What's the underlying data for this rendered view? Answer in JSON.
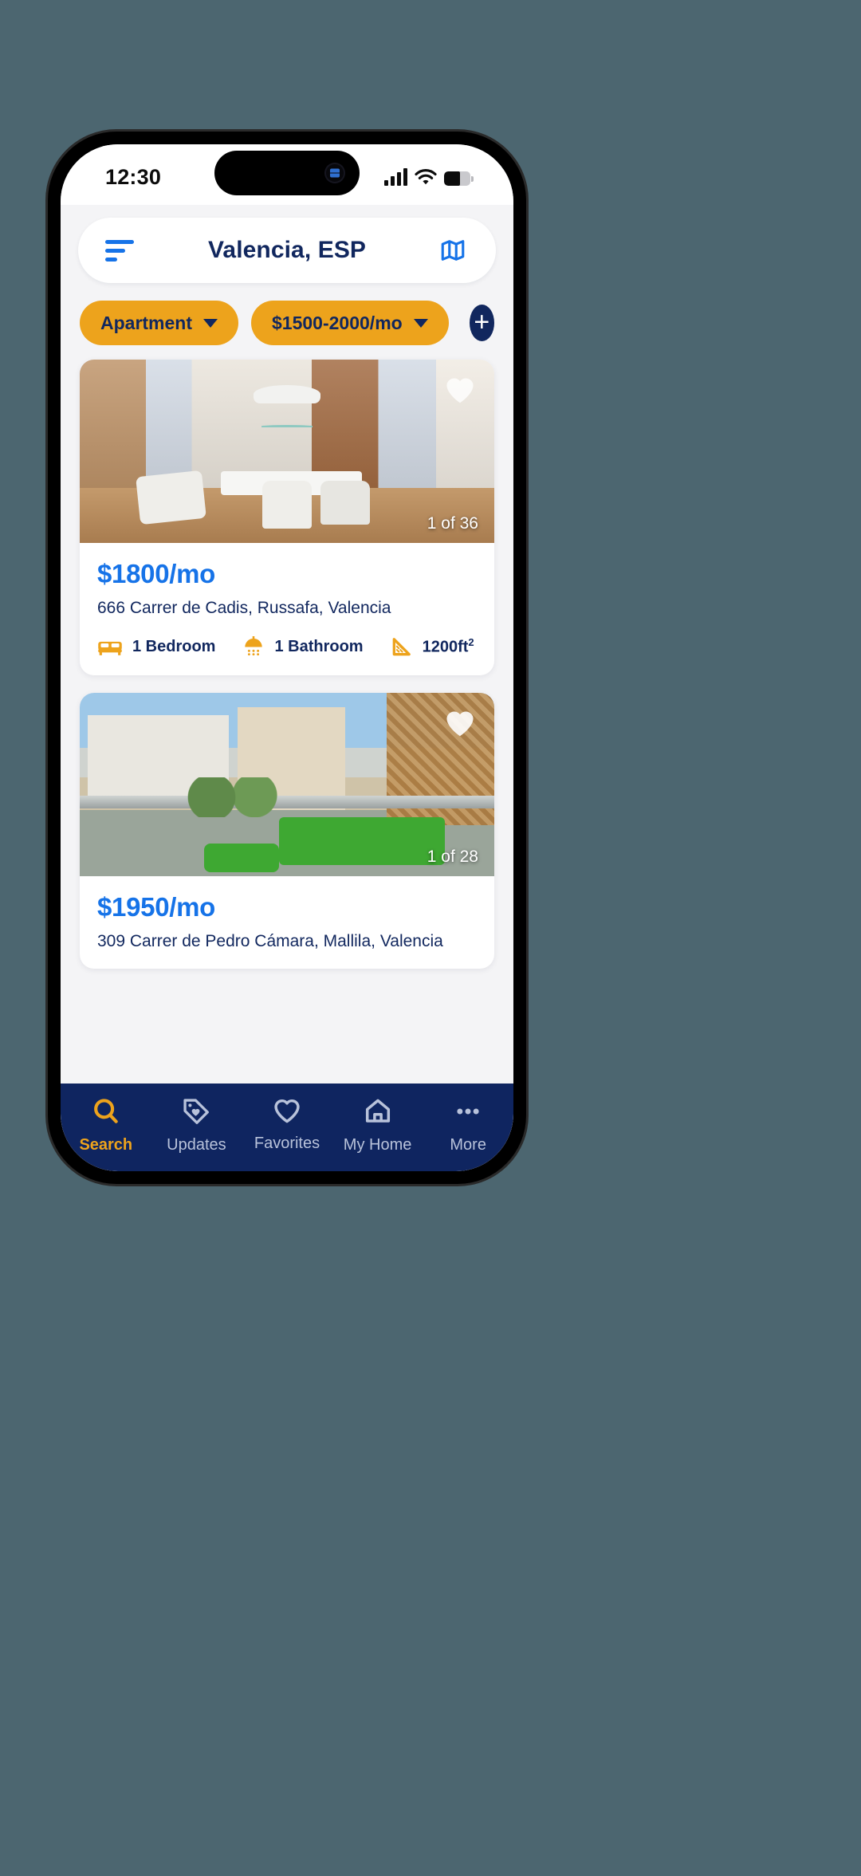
{
  "status_bar": {
    "time": "12:30",
    "signal_icon": "cellular-signal-icon",
    "wifi_icon": "wifi-icon",
    "battery_icon": "battery-icon",
    "battery_level": 62
  },
  "header": {
    "sort_icon": "sort-filter-icon",
    "title": "Valencia, ESP",
    "map_icon": "map-icon"
  },
  "filters": {
    "chips": [
      {
        "label": "Apartment",
        "caret_icon": "chevron-down-icon"
      },
      {
        "label": "$1500-2000/mo",
        "caret_icon": "chevron-down-icon"
      }
    ],
    "add_label": "+",
    "add_icon": "plus-icon"
  },
  "listings": [
    {
      "price": "$1800/mo",
      "address": "666 Carrer de Cadis, Russafa, Valencia",
      "photo_counter": "1 of 36",
      "favorite_icon": "heart-icon",
      "amenities": [
        {
          "icon": "bed-icon",
          "label": "1 Bedroom"
        },
        {
          "icon": "shower-icon",
          "label": "1 Bathroom"
        },
        {
          "icon": "ruler-icon",
          "label": "1200ft",
          "sup": "2"
        }
      ]
    },
    {
      "price": "$1950/mo",
      "address": "309 Carrer de Pedro Cámara, Mallila, Valencia",
      "photo_counter": "1 of 28",
      "favorite_icon": "heart-icon",
      "amenities": []
    }
  ],
  "bottom_nav": {
    "items": [
      {
        "label": "Search",
        "icon": "search-icon",
        "active": true
      },
      {
        "label": "Updates",
        "icon": "tag-heart-icon",
        "active": false
      },
      {
        "label": "Favorites",
        "icon": "heart-icon",
        "active": false
      },
      {
        "label": "My Home",
        "icon": "home-icon",
        "active": false
      },
      {
        "label": "More",
        "icon": "ellipsis-icon",
        "active": false
      }
    ]
  },
  "colors": {
    "navy": "#11275e",
    "nav_navy": "#0f2560",
    "accent_orange": "#eda31c",
    "link_blue": "#1673e8",
    "page_bg": "#f4f4f6",
    "backdrop": "#4c6670"
  }
}
